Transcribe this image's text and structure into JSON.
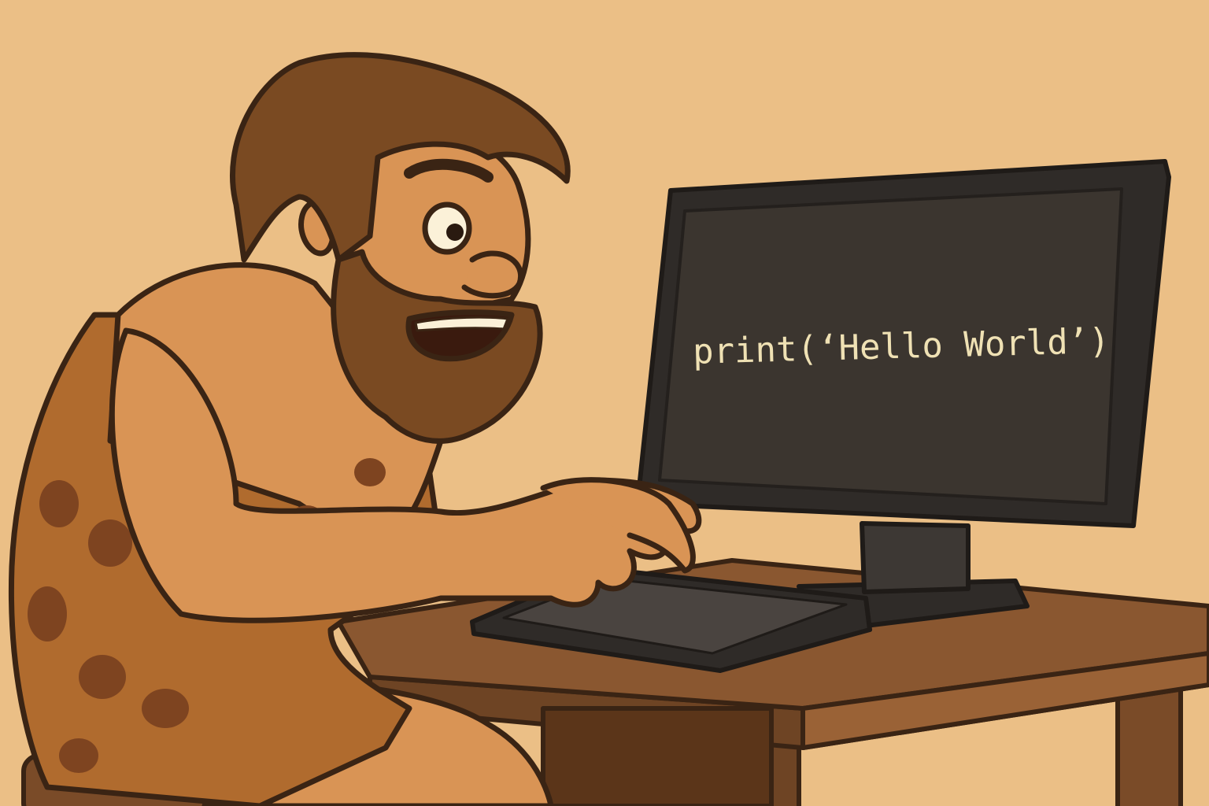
{
  "screen": {
    "code_text": "print(‘Hello World’)"
  },
  "colors": {
    "background": "#ebbf86",
    "screen": "#3b352f",
    "bezel": "#2f2b28",
    "skin": "#d99455",
    "hair": "#7a4a22",
    "fur": "#b06b2e",
    "fur_spots": "#7e4420",
    "desk": "#8a5730",
    "outline": "#3a2414",
    "code_text": "#efe1b4"
  }
}
